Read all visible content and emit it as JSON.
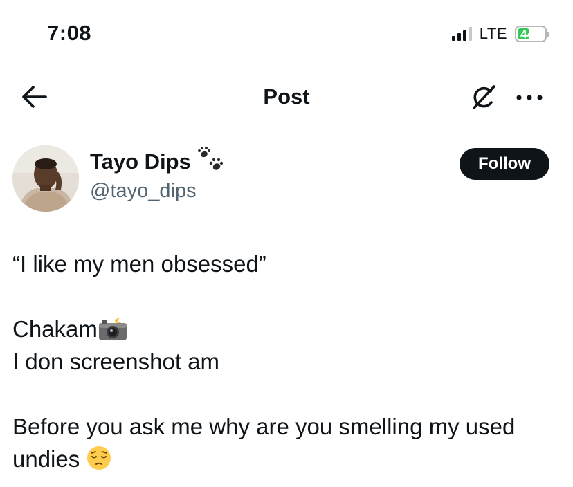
{
  "status_bar": {
    "time": "7:08",
    "network": "LTE",
    "battery_level": 44,
    "battery_label": "44",
    "battery_color": "#34c759"
  },
  "nav": {
    "title": "Post",
    "back_icon": "arrow-left-icon",
    "grok_icon": "grok-slash-circle-icon",
    "more_icon": "more-dots-icon"
  },
  "author": {
    "name": "Tayo Dips",
    "handle": "@tayo_dips",
    "name_emoji_icon": "paw-prints-icon",
    "follow_label": "Follow"
  },
  "post": {
    "line1": "“I like my men obsessed”",
    "line2": "Chakam",
    "line2_emoji_icon": "camera-flash-icon",
    "line3": "I don screenshot am",
    "line4": "Before you ask me why are you smelling my used",
    "line5": "undies",
    "line5_emoji_icon": "pensive-face-icon"
  },
  "colors": {
    "text": "#0f1419",
    "secondary": "#536471",
    "follow_bg": "#0f1419"
  }
}
